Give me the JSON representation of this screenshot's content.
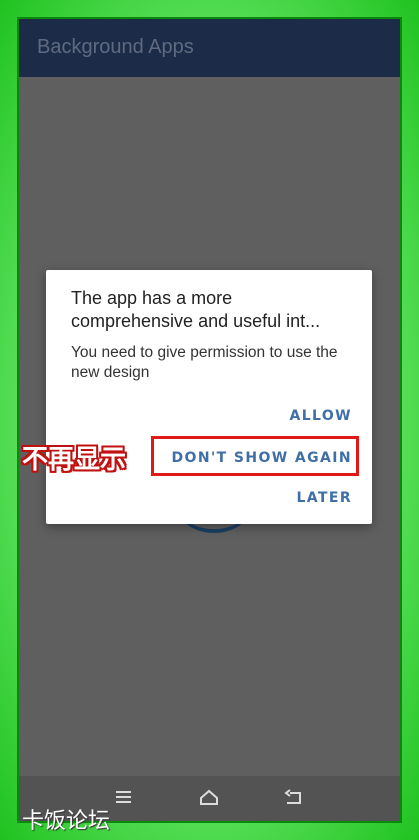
{
  "appbar": {
    "title": "Background Apps"
  },
  "dialog": {
    "title": "The app has a more comprehensive and useful int...",
    "message": "You need to give permission to use the new design",
    "buttons": {
      "allow": "ALLOW",
      "dont_show_again": "DON'T SHOW AGAIN",
      "later": "LATER"
    }
  },
  "annotation": {
    "label": "不再显示"
  },
  "navbar": {
    "icons": [
      "menu-icon",
      "home-icon",
      "back-icon"
    ]
  },
  "watermark": {
    "text": "卡饭论坛"
  },
  "colors": {
    "appbar": "#1c2c48",
    "dialog_button": "#3f6fa6",
    "highlight": "#e01818",
    "frame": "#2fd62f"
  }
}
